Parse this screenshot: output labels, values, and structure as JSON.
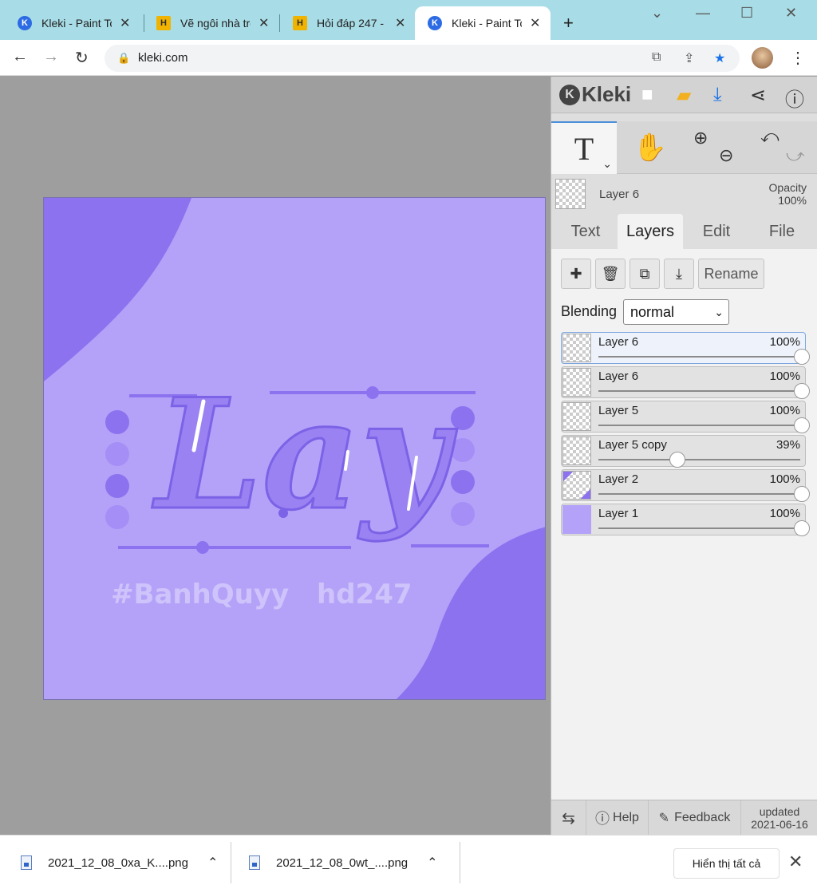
{
  "browser": {
    "tabs": [
      {
        "label": "Kleki - Paint Tool",
        "icon": "kleki-favicon",
        "active": false
      },
      {
        "label": "Vẽ ngôi nhà trên",
        "icon": "hoidap-favicon",
        "active": false
      },
      {
        "label": "Hỏi đáp 247 - ",
        "icon": "hoidap-favicon",
        "active": false
      },
      {
        "label": "Kleki - Paint Tool",
        "icon": "kleki-favicon",
        "active": true
      }
    ],
    "new_tab": "+",
    "url": "kleki.com"
  },
  "artwork": {
    "main_text": "Lay",
    "caption_left": "#BanhQuyy",
    "caption_right": "hd247",
    "colors": {
      "bg": "#b4a2f8",
      "accent": "#8c72ef",
      "mid": "#a58ef5",
      "caption": "#cfc3fb"
    }
  },
  "kleki": {
    "logo": "Kleki",
    "active_tool": "T",
    "layer_name": "Layer 6",
    "opacity_label": "Opacity",
    "opacity_value": "100%",
    "tabs": [
      "Text",
      "Layers",
      "Edit",
      "File"
    ],
    "active_tab": "Layers",
    "rename": "Rename",
    "blending_label": "Blending",
    "blending_value": "normal",
    "layers": [
      {
        "name": "Layer 6",
        "opacity": "100%",
        "opacity_value": 1.0,
        "selected": true
      },
      {
        "name": "Layer 6",
        "opacity": "100%",
        "opacity_value": 1.0,
        "selected": false
      },
      {
        "name": "Layer 5",
        "opacity": "100%",
        "opacity_value": 1.0,
        "selected": false
      },
      {
        "name": "Layer 5 copy",
        "opacity": "39%",
        "opacity_value": 0.39,
        "selected": false
      },
      {
        "name": "Layer 2",
        "opacity": "100%",
        "opacity_value": 1.0,
        "selected": false
      },
      {
        "name": "Layer 1",
        "opacity": "100%",
        "opacity_value": 1.0,
        "selected": false
      }
    ],
    "footer": {
      "help": "Help",
      "feedback": "Feedback",
      "updated_label": "updated",
      "updated_date": "2021-06-16"
    }
  },
  "downloads": {
    "items": [
      "2021_12_08_0xa_K....png",
      "2021_12_08_0wt_....png"
    ],
    "show_all": "Hiển thị tất cả"
  }
}
